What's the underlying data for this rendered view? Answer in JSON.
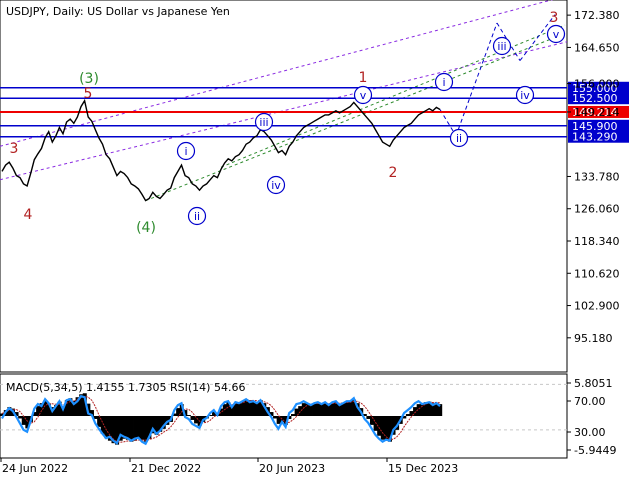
{
  "colors": {
    "background": "#ffffff",
    "grid": "#c8c8c8",
    "price": "#000000",
    "level_blue": "#0000cc",
    "level_red": "#ee0000",
    "label_blue_bg": "#0000cc",
    "label_red_bg": "#ee0000",
    "wave_red": "#b22222",
    "wave_green": "#2e8b2e",
    "wave_blue": "#0000cc",
    "channel_purple": "#8a2be2",
    "trend_green": "#2e8b2e",
    "macd_hist": "#000000",
    "macd_signal": "#b22222",
    "rsi": "#1e90ff"
  },
  "chart_data": [
    {
      "type": "line",
      "title": "USDJPY, Daily:  US Dollar vs Japanese Yen",
      "ylim": [
        87.0,
        176.0
      ],
      "y_ticks": [
        "172.380",
        "164.650",
        "156.000",
        "149.214",
        "133.780",
        "126.060",
        "118.340",
        "110.620",
        "102.900",
        "95.180"
      ],
      "x_ticks": [
        "24 Jun 2022",
        "21 Dec 2022",
        "20 Jun 2023",
        "15 Dec 2023"
      ],
      "levels": [
        {
          "label": "155.000",
          "value": 155.0,
          "color": "blue"
        },
        {
          "label": "152.500",
          "value": 152.5,
          "color": "blue"
        },
        {
          "label": "149.214",
          "value": 149.214,
          "color": "red"
        },
        {
          "label": "145.900",
          "value": 145.9,
          "color": "blue"
        },
        {
          "label": "143.290",
          "value": 143.29,
          "color": "blue"
        }
      ],
      "series": [
        {
          "values": [
            135.0,
            136.5,
            137.2,
            135.8,
            134.0,
            133.5,
            132.0,
            131.5,
            134.5,
            137.8,
            139.2,
            140.5,
            143.0,
            144.5,
            142.0,
            143.5,
            145.5,
            144.0,
            146.8,
            147.5,
            146.5,
            148.0,
            150.5,
            151.9,
            148.0,
            147.0,
            145.0,
            143.0,
            141.5,
            139.0,
            138.0,
            136.0,
            134.0,
            135.0,
            134.5,
            133.5,
            132.0,
            131.5,
            130.8,
            129.5,
            128.0,
            128.5,
            130.0,
            129.0,
            128.5,
            129.5,
            130.5,
            131.0,
            133.5,
            135.0,
            136.5,
            134.0,
            133.5,
            132.0,
            131.5,
            130.5,
            131.5,
            132.0,
            133.0,
            134.0,
            133.5,
            135.5,
            137.0,
            138.0,
            137.5,
            138.5,
            139.0,
            140.0,
            141.5,
            142.0,
            143.0,
            143.5,
            145.0,
            144.5,
            143.5,
            142.5,
            141.0,
            139.5,
            140.0,
            139.0,
            141.0,
            142.0,
            143.5,
            144.5,
            145.5,
            146.0,
            146.5,
            147.0,
            147.5,
            148.0,
            148.5,
            148.5,
            149.0,
            149.5,
            149.0,
            149.5,
            150.0,
            150.5,
            151.5,
            150.5,
            149.5,
            148.5,
            147.5,
            146.5,
            145.0,
            143.5,
            142.0,
            141.5,
            141.0,
            142.5,
            143.5,
            144.5,
            145.5,
            146.0,
            146.5,
            147.5,
            148.5,
            149.0,
            149.5,
            150.0,
            149.5,
            150.3,
            149.8
          ]
        }
      ],
      "waves": [
        {
          "text": "3",
          "style": "red"
        },
        {
          "text": "4",
          "style": "red"
        },
        {
          "text": "(3)",
          "style": "green"
        },
        {
          "text": "5",
          "style": "red"
        },
        {
          "text": "(4)",
          "style": "green"
        },
        {
          "text": "i",
          "style": "circle"
        },
        {
          "text": "ii",
          "style": "circle"
        },
        {
          "text": "iii",
          "style": "circle"
        },
        {
          "text": "iv",
          "style": "circle"
        },
        {
          "text": "1",
          "style": "red"
        },
        {
          "text": "v",
          "style": "circle"
        },
        {
          "text": "2",
          "style": "red"
        },
        {
          "text": "i",
          "style": "circle"
        },
        {
          "text": "ii",
          "style": "circle"
        },
        {
          "text": "iii",
          "style": "circle"
        },
        {
          "text": "iv",
          "style": "circle"
        },
        {
          "text": "v",
          "style": "circle"
        },
        {
          "text": "3",
          "style": "red"
        }
      ]
    },
    {
      "type": "line",
      "title": "MACD(5,34,5) 1.4155 1.7305 RSI(14) 54.66",
      "ylim": [
        -8.5,
        8.5
      ],
      "y_ticks": [
        "5.8051",
        "70.00",
        "30.00",
        "-5.9449"
      ],
      "series": [
        {
          "name": "MACD",
          "values": [
            0.5,
            1.2,
            1.8,
            1.5,
            0.8,
            -0.5,
            -1.8,
            -2.5,
            -1.2,
            0.8,
            2.0,
            2.6,
            3.0,
            2.5,
            1.8,
            2.2,
            2.9,
            2.0,
            3.2,
            3.6,
            3.1,
            3.8,
            4.4,
            4.6,
            2.5,
            1.2,
            -0.6,
            -2.2,
            -3.6,
            -4.5,
            -5.0,
            -5.5,
            -5.8,
            -5.0,
            -4.6,
            -4.8,
            -5.2,
            -5.0,
            -4.5,
            -4.8,
            -5.2,
            -4.6,
            -3.5,
            -3.8,
            -3.2,
            -2.6,
            -1.8,
            -1.2,
            0.5,
            1.6,
            2.4,
            1.2,
            0.2,
            -0.8,
            -1.5,
            -2.0,
            -1.2,
            -0.5,
            0.2,
            0.8,
            0.5,
            1.5,
            2.4,
            2.8,
            2.2,
            2.6,
            2.8,
            3.0,
            3.4,
            3.2,
            3.0,
            2.8,
            3.2,
            2.6,
            1.8,
            0.8,
            -0.5,
            -1.6,
            -1.2,
            -1.8,
            -0.6,
            0.4,
            1.5,
            2.0,
            2.6,
            2.6,
            2.4,
            2.5,
            2.6,
            2.5,
            2.6,
            2.4,
            2.6,
            2.8,
            2.5,
            2.7,
            2.9,
            3.0,
            3.3,
            2.6,
            1.6,
            0.4,
            -0.6,
            -1.8,
            -3.0,
            -4.0,
            -4.8,
            -5.0,
            -5.2,
            -3.8,
            -2.8,
            -1.6,
            -0.5,
            0.4,
            1.0,
            1.8,
            2.4,
            2.6,
            2.8,
            2.9,
            2.6,
            2.7,
            2.4
          ]
        },
        {
          "name": "RSI",
          "values": [
            -0.5,
            0.8,
            1.6,
            1.0,
            -0.2,
            -1.5,
            -2.8,
            -3.2,
            -1.0,
            1.5,
            2.4,
            2.0,
            3.4,
            2.6,
            1.0,
            2.0,
            3.0,
            1.4,
            3.2,
            3.4,
            2.4,
            3.0,
            4.0,
            3.8,
            0.5,
            0.2,
            -1.5,
            -2.6,
            -3.6,
            -4.5,
            -4.2,
            -5.0,
            -5.5,
            -3.8,
            -4.2,
            -4.5,
            -5.0,
            -4.6,
            -4.4,
            -5.2,
            -5.6,
            -4.2,
            -2.6,
            -3.6,
            -3.0,
            -2.0,
            -1.2,
            -0.8,
            1.2,
            2.2,
            2.6,
            -0.2,
            -0.6,
            -1.6,
            -2.0,
            -2.4,
            -0.8,
            -0.4,
            0.6,
            1.2,
            0.2,
            2.0,
            2.8,
            3.0,
            1.8,
            2.8,
            2.6,
            3.0,
            3.4,
            2.8,
            3.0,
            2.6,
            3.2,
            2.0,
            0.8,
            -0.2,
            -1.6,
            -2.6,
            -1.2,
            -2.2,
            0.6,
            1.2,
            2.4,
            2.6,
            3.0,
            2.6,
            2.2,
            2.6,
            2.8,
            2.4,
            2.8,
            2.2,
            2.8,
            3.0,
            2.2,
            2.6,
            3.0,
            3.0,
            3.6,
            1.8,
            0.8,
            -0.6,
            -1.4,
            -2.6,
            -3.8,
            -4.6,
            -5.2,
            -4.8,
            -5.0,
            -2.8,
            -2.0,
            -0.8,
            0.6,
            1.2,
            1.8,
            2.6,
            3.0,
            2.4,
            2.6,
            2.8,
            2.2,
            2.6,
            2.0
          ]
        }
      ]
    }
  ]
}
